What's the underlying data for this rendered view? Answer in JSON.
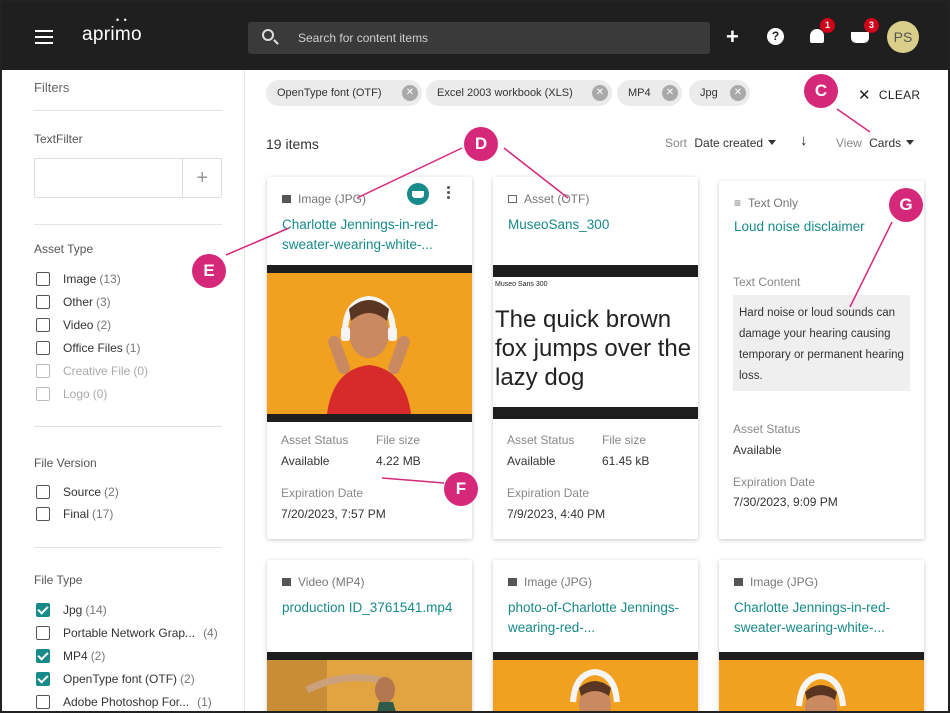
{
  "app": {
    "logo": "aprimo"
  },
  "header": {
    "search_placeholder": "Search for content items",
    "notifications_count": "1",
    "cart_count": "3",
    "avatar_initials": "PS"
  },
  "sidebar": {
    "filters_title": "Filters",
    "textfilter_title": "TextFilter",
    "asset_type": {
      "title": "Asset Type",
      "items": [
        {
          "label": "Image",
          "count": "(13)",
          "checked": false,
          "disabled": false
        },
        {
          "label": "Other",
          "count": "(3)",
          "checked": false,
          "disabled": false
        },
        {
          "label": "Video",
          "count": "(2)",
          "checked": false,
          "disabled": false
        },
        {
          "label": "Office Files",
          "count": "(1)",
          "checked": false,
          "disabled": false
        },
        {
          "label": "Creative File",
          "count": "(0)",
          "checked": false,
          "disabled": true
        },
        {
          "label": "Logo",
          "count": "(0)",
          "checked": false,
          "disabled": true
        }
      ]
    },
    "file_version": {
      "title": "File Version",
      "items": [
        {
          "label": "Source",
          "count": "(2)",
          "checked": false
        },
        {
          "label": "Final",
          "count": "(17)",
          "checked": false
        }
      ]
    },
    "file_type": {
      "title": "File Type",
      "items": [
        {
          "label": "Jpg",
          "count": "(14)",
          "checked": true
        },
        {
          "label": "Portable Network Grap...",
          "count": "(4)",
          "checked": false
        },
        {
          "label": "MP4",
          "count": "(2)",
          "checked": true
        },
        {
          "label": "OpenType font (OTF)",
          "count": "(2)",
          "checked": true
        },
        {
          "label": "Adobe Photoshop For...",
          "count": "(1)",
          "checked": false
        }
      ]
    }
  },
  "chips": [
    {
      "label": "OpenType font (OTF)"
    },
    {
      "label": "Excel 2003 workbook (XLS)"
    },
    {
      "label": "MP4"
    },
    {
      "label": "Jpg"
    }
  ],
  "toolbar": {
    "clear_label": "CLEAR",
    "items_count": "19 items",
    "sort_label": "Sort",
    "sort_value": "Date created",
    "view_label": "View",
    "view_value": "Cards"
  },
  "callouts": {
    "c": "C",
    "d": "D",
    "e": "E",
    "f": "F",
    "g": "G"
  },
  "cards": [
    {
      "type": "Image (JPG)",
      "title": "Charlotte Jennings-in-red-sweater-wearing-white-...",
      "status_label": "Asset Status",
      "status": "Available",
      "size_label": "File size",
      "size": "4.22 MB",
      "exp_label": "Expiration Date",
      "exp": "7/20/2023, 7:57 PM"
    },
    {
      "type": "Asset (OTF)",
      "title": "MuseoSans_300",
      "font_name": "Museo Sans 300",
      "sample": "The quick brown fox jumps over the lazy dog",
      "status_label": "Asset Status",
      "status": "Available",
      "size_label": "File size",
      "size": "61.45 kB",
      "exp_label": "Expiration Date",
      "exp": "7/9/2023, 4:40 PM"
    },
    {
      "type": "Text Only",
      "title": "Loud noise disclaimer",
      "text_label": "Text Content",
      "text": "Hard noise or loud sounds can damage your hearing causing temporary or permanent hearing loss.",
      "status_label": "Asset Status",
      "status": "Available",
      "exp_label": "Expiration Date",
      "exp": "7/30/2023, 9:09 PM"
    },
    {
      "type": "Video (MP4)",
      "title": "production ID_3761541.mp4"
    },
    {
      "type": "Image (JPG)",
      "title": "photo-of-Charlotte Jennings-wearing-red-..."
    },
    {
      "type": "Image (JPG)",
      "title": "Charlotte Jennings-in-red-sweater-wearing-white-..."
    }
  ],
  "colors": {
    "accent": "#178a8a",
    "callout": "#d6287a",
    "thumb_bg": "#f1a020",
    "topbar": "#1f1f1f"
  }
}
